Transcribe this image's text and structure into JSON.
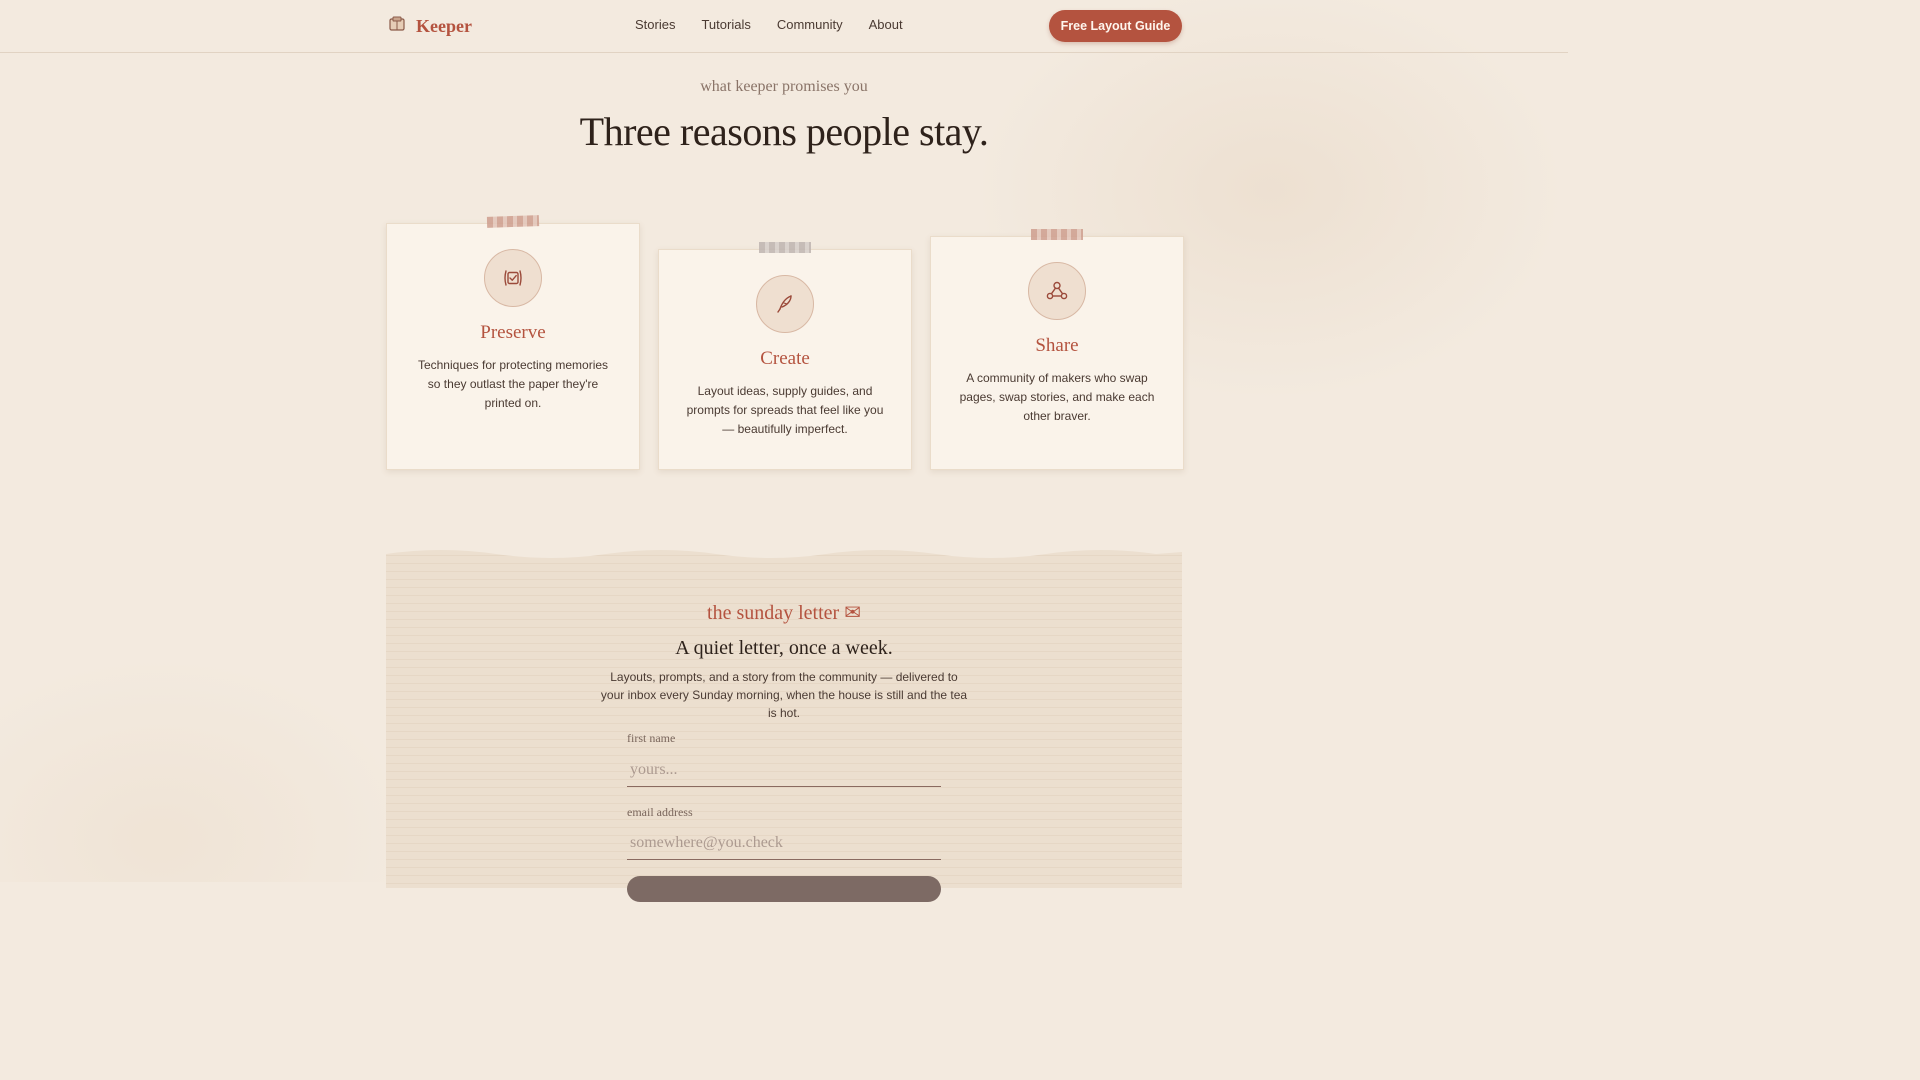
{
  "header": {
    "brand": "Keeper",
    "nav": [
      "Stories",
      "Tutorials",
      "Community",
      "About"
    ],
    "cta": "Free Layout Guide"
  },
  "hero": {
    "eyebrow": "what keeper promises you",
    "title": "Three reasons people stay."
  },
  "cards": [
    {
      "icon": "preserve-icon",
      "title": "Preserve",
      "text": "Techniques for protecting memories so they outlast the paper they're printed on."
    },
    {
      "icon": "quill-pen-icon",
      "title": "Create",
      "text": "Layout ideas, supply guides, and prompts for spreads that feel like you — beautifully imperfect."
    },
    {
      "icon": "network-icon",
      "title": "Share",
      "text": "A community of makers who swap pages, swap stories, and make each other braver."
    }
  ],
  "newsletter": {
    "eyebrow": "the sunday letter ✉",
    "title": "A quiet letter, once a week.",
    "description": "Layouts, prompts, and a story from the community — delivered to your inbox every Sunday morning, when the house is still and the tea is hot.",
    "first_name_label": "first name",
    "first_name_placeholder": "yours...",
    "email_label": "email address",
    "email_placeholder": "somewhere@you.check"
  },
  "colors": {
    "accent": "#b4533f",
    "background": "#f3eadf",
    "card": "#faf3ea",
    "text": "#2e221b"
  }
}
